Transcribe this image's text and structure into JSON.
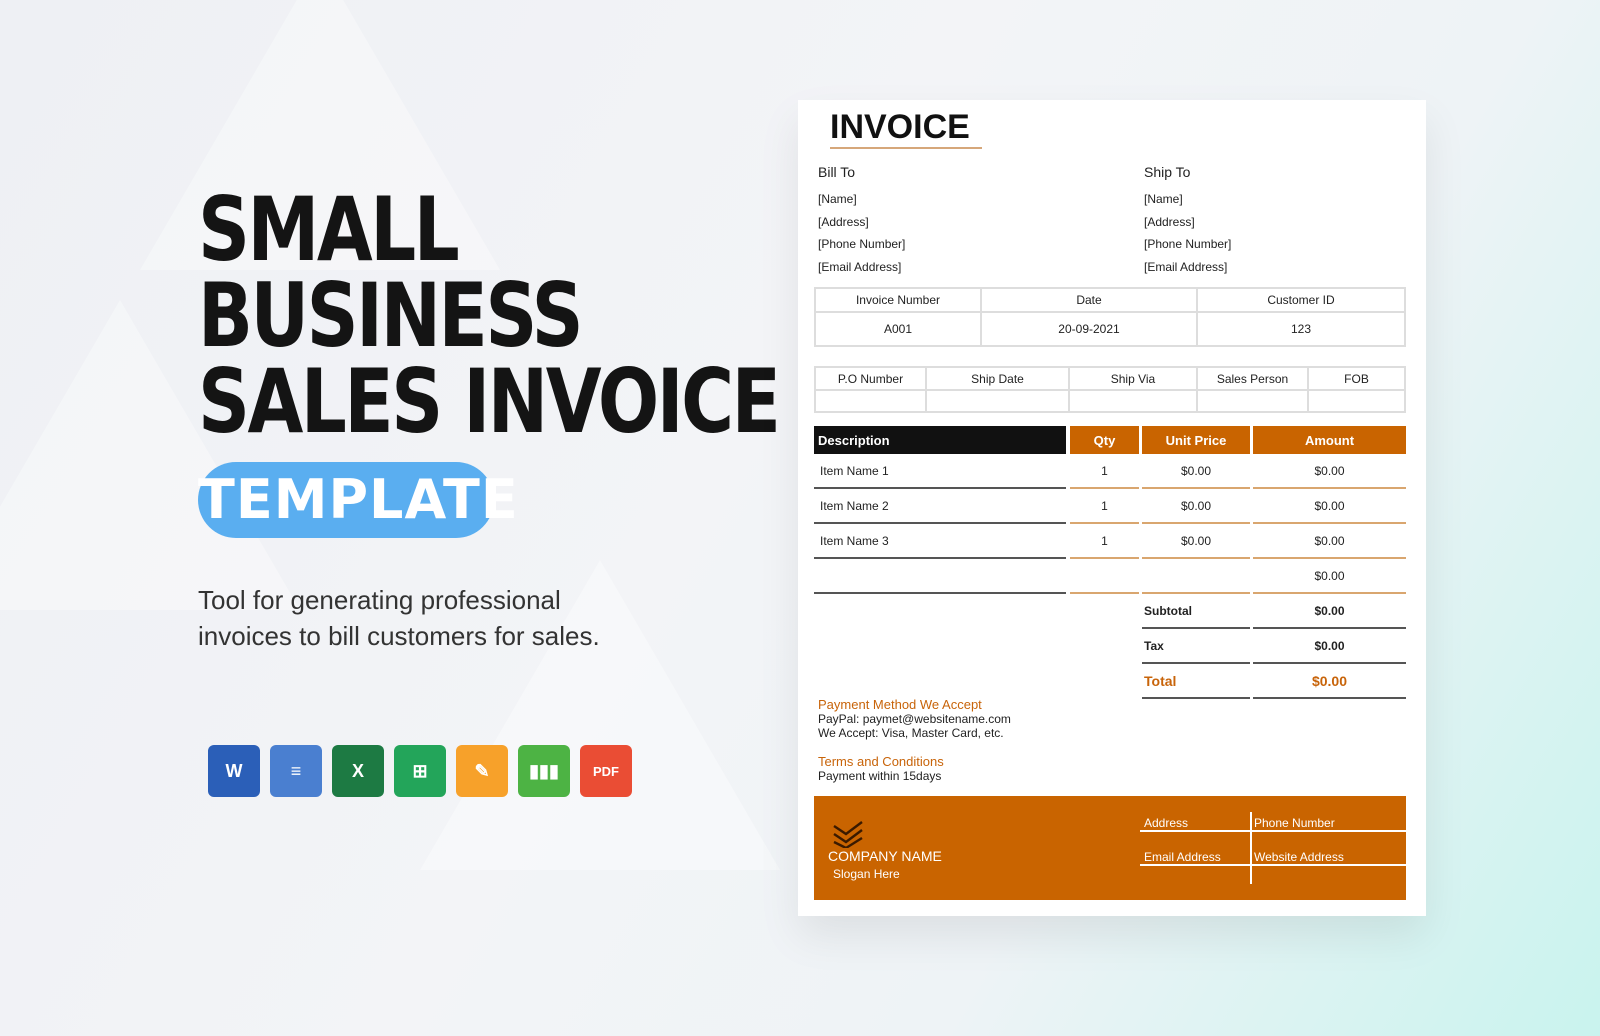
{
  "headline": {
    "line1": "SMALL",
    "line2": "BUSINESS",
    "line3": "SALES INVOICE",
    "badge": "TEMPLATE",
    "description": "Tool for generating professional invoices to bill customers for sales."
  },
  "formats": [
    {
      "icon": "word-icon",
      "label": "W",
      "color": "#2b5fb8"
    },
    {
      "icon": "google-docs-icon",
      "label": "≡",
      "color": "#4a7fd0"
    },
    {
      "icon": "excel-icon",
      "label": "X",
      "color": "#1d7a43"
    },
    {
      "icon": "google-sheets-icon",
      "label": "⊞",
      "color": "#23a55a"
    },
    {
      "icon": "pages-icon",
      "label": "✎",
      "color": "#f7a12a"
    },
    {
      "icon": "numbers-icon",
      "label": "▮▮▮",
      "color": "#4db344"
    },
    {
      "icon": "pdf-icon",
      "label": "PDF",
      "color": "#ea4d34"
    }
  ],
  "invoice": {
    "title": "INVOICE",
    "bill_to": {
      "heading": "Bill To",
      "lines": [
        "[Name]",
        "[Address]",
        "[Phone Number]",
        "[Email Address]"
      ]
    },
    "ship_to": {
      "heading": "Ship To",
      "lines": [
        "[Name]",
        "[Address]",
        "[Phone Number]",
        "[Email Address]"
      ]
    },
    "meta": {
      "headers": [
        "Invoice Number",
        "Date",
        "Customer ID"
      ],
      "values": [
        "A001",
        "20-09-2021",
        "123"
      ]
    },
    "shipping": {
      "headers": [
        "P.O Number",
        "Ship Date",
        "Ship Via",
        "Sales Person",
        "FOB"
      ],
      "values": [
        "",
        "",
        "",
        "",
        ""
      ]
    },
    "items": {
      "headers": [
        "Description",
        "Qty",
        "Unit Price",
        "Amount"
      ],
      "rows": [
        [
          "Item Name 1",
          "1",
          "$0.00",
          "$0.00"
        ],
        [
          "Item Name 2",
          "1",
          "$0.00",
          "$0.00"
        ],
        [
          "Item Name 3",
          "1",
          "$0.00",
          "$0.00"
        ],
        [
          "",
          "",
          "",
          "$0.00"
        ]
      ]
    },
    "totals": [
      {
        "label": "Subtotal",
        "value": "$0.00"
      },
      {
        "label": "Tax",
        "value": "$0.00"
      },
      {
        "label": "Total",
        "value": "$0.00"
      }
    ],
    "payment": {
      "heading": "Payment Method We Accept",
      "lines": [
        "PayPal: paymet@websitename.com",
        "We Accept: Visa, Master Card, etc."
      ]
    },
    "terms": {
      "heading": "Terms and Conditions",
      "text": "Payment within 15days"
    },
    "footer": {
      "company": "COMPANY NAME",
      "slogan": "Slogan Here",
      "address": "Address",
      "phone": "Phone Number",
      "email": "Email Address",
      "website": "Website Address"
    },
    "accent": "#c96400"
  }
}
